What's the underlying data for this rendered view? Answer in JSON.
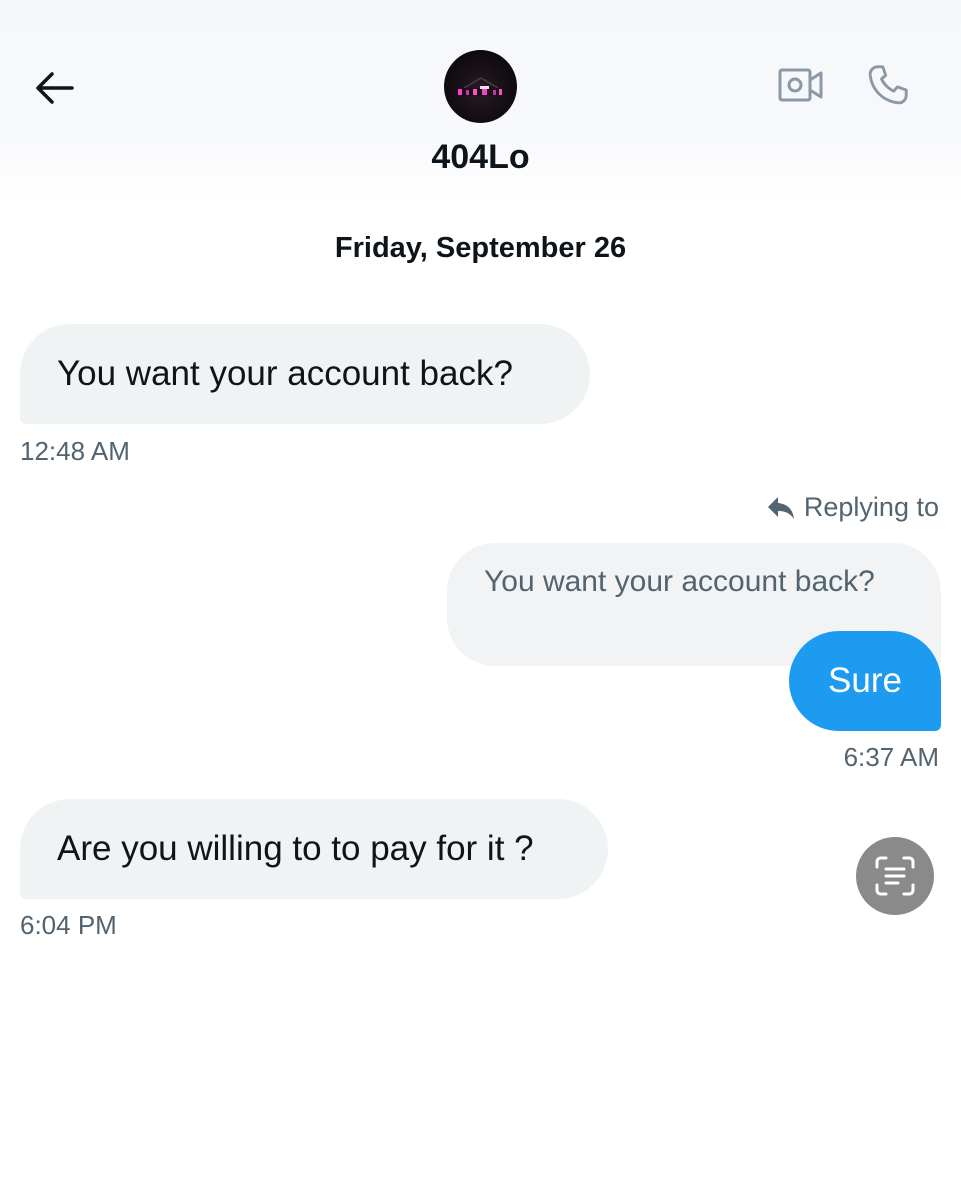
{
  "header": {
    "username": "404Lo",
    "back_icon": "arrow-left-icon",
    "video_icon": "video-call-icon",
    "call_icon": "phone-icon"
  },
  "conversation": {
    "date_separator": "Friday, September 26",
    "messages": [
      {
        "direction": "incoming",
        "text": "You want your account back?",
        "time": "12:48 AM"
      },
      {
        "direction": "outgoing",
        "replying_label": "Replying to",
        "quoted_text": "You want your account back?",
        "text": "Sure",
        "time": "6:37 AM"
      },
      {
        "direction": "incoming",
        "text": "Are you willing to to pay for it ?",
        "time": "6:04 PM"
      }
    ]
  },
  "floating": {
    "scan_icon": "text-scan-icon"
  },
  "colors": {
    "accent": "#1d9bf0",
    "incoming_bubble": "#eff3f4",
    "secondary_text": "#536471",
    "scan_button": "#8a8a8a"
  }
}
